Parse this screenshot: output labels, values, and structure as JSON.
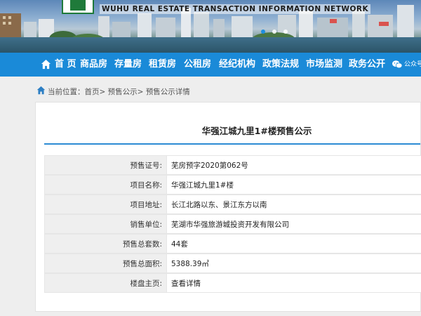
{
  "banner": {
    "logo_text": "WUHU REAL ESTATE TRANSACTION INFORMATION NETWORK",
    "slide_count": 3,
    "active_slide": 1
  },
  "nav": {
    "items": [
      {
        "label": "首 页",
        "icon": "home-icon"
      },
      {
        "label": "商品房"
      },
      {
        "label": "存量房"
      },
      {
        "label": "租赁房"
      },
      {
        "label": "公租房"
      },
      {
        "label": "经纪机构"
      },
      {
        "label": "政策法规"
      },
      {
        "label": "市场监测"
      },
      {
        "label": "政务公开"
      },
      {
        "label": "公众号",
        "icon": "wechat-icon"
      }
    ]
  },
  "breadcrumb": {
    "prefix": "当前位置：",
    "items": [
      "首页",
      "预售公示",
      "预售公示详情"
    ],
    "separator": ">"
  },
  "detail": {
    "title": "华强江城九里1#楼预售公示",
    "rows": [
      {
        "label": "预售证号:",
        "value": "芜房预字2020第062号"
      },
      {
        "label": "项目名称:",
        "value": "华强江城九里1#楼"
      },
      {
        "label": "项目地址:",
        "value": "长江北路以东、景江东方以南"
      },
      {
        "label": "销售单位:",
        "value": "芜湖市华强旅游城投资开发有限公司"
      },
      {
        "label": "预售总套数:",
        "value": "44套"
      },
      {
        "label": "预售总面积:",
        "value": "5388.39㎡"
      },
      {
        "label": "楼盘主页:",
        "value": "查看详情"
      }
    ]
  },
  "colors": {
    "nav_bg": "#1a8ad8",
    "title_rule": "#2d8bd4",
    "logo_green": "#1f7a3a"
  }
}
